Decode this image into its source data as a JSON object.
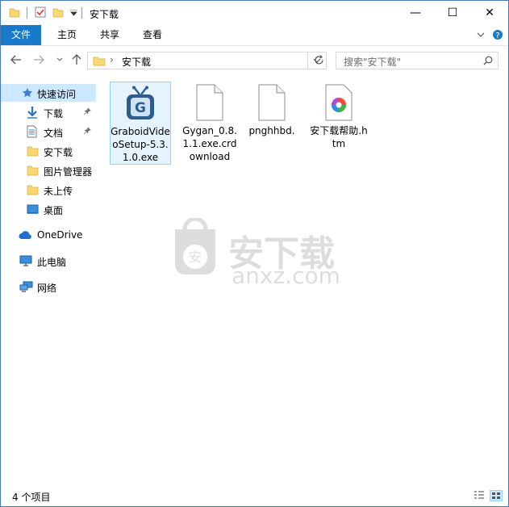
{
  "window": {
    "title": "安下载",
    "controls": {
      "minimize": "—",
      "maximize": "☐",
      "close": "✕"
    }
  },
  "ribbon": {
    "tabs": [
      "文件",
      "主页",
      "共享",
      "查看"
    ]
  },
  "address": {
    "separator": "›",
    "path": "安下载",
    "search_placeholder": "搜索\"安下载\""
  },
  "sidebar": {
    "items": [
      {
        "label": "快速访问",
        "icon": "star-icon",
        "selected": true
      },
      {
        "label": "下载",
        "icon": "download-icon",
        "pinned": true
      },
      {
        "label": "文档",
        "icon": "document-icon",
        "pinned": true
      },
      {
        "label": "安下载",
        "icon": "folder-icon"
      },
      {
        "label": "图片管理器",
        "icon": "folder-icon"
      },
      {
        "label": "未上传",
        "icon": "folder-icon"
      },
      {
        "label": "桌面",
        "icon": "desktop-icon"
      },
      {
        "label": "OneDrive",
        "icon": "cloud-icon"
      },
      {
        "label": "此电脑",
        "icon": "computer-icon"
      },
      {
        "label": "网络",
        "icon": "network-icon"
      }
    ]
  },
  "files": [
    {
      "name": "GraboidVideoSetup-5.3.1.0.exe",
      "icon": "graboid-tv-icon",
      "selected": true
    },
    {
      "name": "Gygan_0.8.1.1.exe.crdownload",
      "icon": "blank-file-icon"
    },
    {
      "name": "pnghhbd.",
      "icon": "blank-file-icon"
    },
    {
      "name": "安下载帮助.htm",
      "icon": "colorful-browser-icon"
    }
  ],
  "status": {
    "item_count": "4 个项目"
  },
  "watermark": {
    "text": "安下载",
    "domain": "anxz.com",
    "shield_char": "安"
  },
  "colors": {
    "file_tab": "#1979ca",
    "selection": "#cce8ff",
    "folder": "#f8d775"
  }
}
